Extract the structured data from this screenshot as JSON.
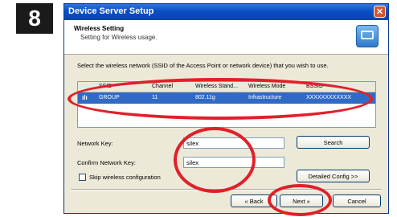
{
  "step_number": "8",
  "window": {
    "title": "Device Server Setup",
    "close_glyph": "✕"
  },
  "header": {
    "title": "Wireless Setting",
    "subtitle": "Setting for Wireless usage."
  },
  "instruction": "Select the wireless network (SSID of the Access Point or network device) that you wish to use.",
  "network_list": {
    "columns": [
      "SSID",
      "Channel",
      "Wireless Stand...",
      "Wireless Mode",
      "BSSID"
    ],
    "rows": [
      {
        "ssid": "GROUP",
        "channel": "11",
        "standard": "802.11g",
        "mode": "Infrastructure",
        "bssid": "XXXXXXXXXXXX"
      }
    ]
  },
  "form": {
    "network_key_label": "Network Key:",
    "network_key_value": "silex",
    "confirm_key_label": "Confirm Network Key:",
    "confirm_key_value": "silex",
    "skip_label": "Skip wireless configuration"
  },
  "buttons": {
    "search": "Search",
    "detailed_config": "Detailed Config >>",
    "back": "« Back",
    "next": "Next »",
    "cancel": "Cancel"
  },
  "colors": {
    "highlight_oval": "#e0202a",
    "selection": "#316ac5"
  },
  "icons": {
    "network_row": "wireless-network-icon",
    "header": "device-server-icon",
    "close": "close-icon"
  }
}
